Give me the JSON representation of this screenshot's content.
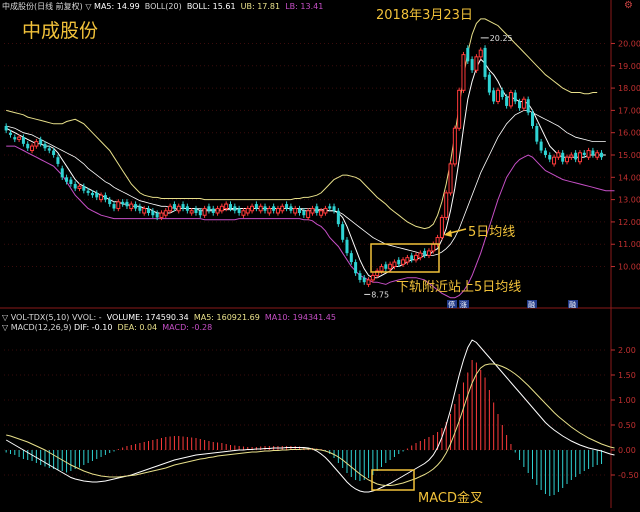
{
  "header": {
    "stock": "中成股份(日线 前复权)",
    "ma5": "MA5: 14.99",
    "boll": "BOLL(20)",
    "boll_mid": "BOLL: 15.61",
    "ub": "UB: 17.81",
    "lb": "LB: 13.41"
  },
  "vol_header": {
    "name": "VOL-TDX(5,10)",
    "vvol": "VVOL: -",
    "volume": "VOLUME: 174590.34",
    "ma5": "MA5: 160921.69",
    "ma10": "MA10: 194341.45"
  },
  "macd_header": {
    "name": "MACD(12,26,9)",
    "dif": "DIF: -0.10",
    "dea": "DEA: 0.04",
    "macd": "MACD: -0.28"
  },
  "annotations": {
    "title": "中成股份",
    "date": "2018年3月23日",
    "ma5_label": "5日均线",
    "lower_band": "下轨附近站上5日均线",
    "macd_cross": "MACD金叉",
    "high_price": "20.25",
    "low_price": "8.75"
  },
  "markers": [
    "停",
    "涨",
    "融",
    "融"
  ],
  "colors": {
    "up": "#ff3b3b",
    "down": "#2fd3d3",
    "ma5": "#ffffff",
    "boll_mid": "#ffffff",
    "boll_upper": "#e8e08a",
    "boll_lower": "#c64fc6",
    "annotation": "#f2c23a",
    "axis": "#c03030"
  },
  "chart_data": [
    {
      "type": "candlestick",
      "yticks": [
        "20.00",
        "19.00",
        "18.00",
        "17.00",
        "16.00",
        "15.00",
        "14.00",
        "13.00",
        "12.00",
        "11.00",
        "10.00"
      ],
      "ylim": [
        8.5,
        21.5
      ],
      "close": [
        16.1,
        15.9,
        15.7,
        15.8,
        15.5,
        15.3,
        15.4,
        15.6,
        15.5,
        15.3,
        15.2,
        15.0,
        14.6,
        14.0,
        13.8,
        13.7,
        13.5,
        13.6,
        13.4,
        13.3,
        13.2,
        13.1,
        13.2,
        13.0,
        12.8,
        12.6,
        12.9,
        12.8,
        12.7,
        12.8,
        12.6,
        12.5,
        12.6,
        12.4,
        12.3,
        12.2,
        12.4,
        12.5,
        12.7,
        12.6,
        12.7,
        12.6,
        12.5,
        12.5,
        12.4,
        12.3,
        12.6,
        12.5,
        12.4,
        12.6,
        12.7,
        12.8,
        12.6,
        12.5,
        12.4,
        12.5,
        12.6,
        12.7,
        12.6,
        12.7,
        12.5,
        12.6,
        12.5,
        12.6,
        12.7,
        12.6,
        12.5,
        12.6,
        12.4,
        12.3,
        12.5,
        12.6,
        12.4,
        12.5,
        12.6,
        12.6,
        12.5,
        11.9,
        11.2,
        10.6,
        10.2,
        9.7,
        9.4,
        9.3,
        9.4,
        9.6,
        9.8,
        10.0,
        9.9,
        10.1,
        10.2,
        10.1,
        10.3,
        10.4,
        10.3,
        10.5,
        10.6,
        10.5,
        10.7,
        11.0,
        11.3,
        12.2,
        13.3,
        14.6,
        16.2,
        17.9,
        19.5,
        19.2,
        18.8,
        19.4,
        19.7,
        18.5,
        17.8,
        17.4,
        17.9,
        17.6,
        17.2,
        17.8,
        17.4,
        17.1,
        17.5,
        16.9,
        16.3,
        15.6,
        15.2,
        15.0,
        14.8,
        14.9,
        15.1,
        14.7,
        14.9,
        15.0,
        14.8,
        15.1,
        15.0,
        15.2,
        15.0,
        15.1,
        14.9,
        15.0
      ],
      "open": [
        16.3,
        16.0,
        15.8,
        15.7,
        15.8,
        15.5,
        15.2,
        15.4,
        15.7,
        15.5,
        15.3,
        15.2,
        14.9,
        14.4,
        14.0,
        13.9,
        13.7,
        13.5,
        13.6,
        13.4,
        13.3,
        13.3,
        13.0,
        13.2,
        13.0,
        12.8,
        12.6,
        12.9,
        12.9,
        12.6,
        12.8,
        12.7,
        12.4,
        12.6,
        12.5,
        12.4,
        12.2,
        12.3,
        12.5,
        12.8,
        12.5,
        12.8,
        12.7,
        12.4,
        12.6,
        12.5,
        12.3,
        12.7,
        12.6,
        12.4,
        12.5,
        12.6,
        12.8,
        12.7,
        12.6,
        12.3,
        12.4,
        12.5,
        12.8,
        12.5,
        12.7,
        12.4,
        12.7,
        12.4,
        12.5,
        12.8,
        12.7,
        12.4,
        12.6,
        12.5,
        12.2,
        12.4,
        12.7,
        12.3,
        12.4,
        12.7,
        12.7,
        12.5,
        11.9,
        11.2,
        10.6,
        10.2,
        9.7,
        9.5,
        9.2,
        9.4,
        9.6,
        9.8,
        10.1,
        9.9,
        10.0,
        10.3,
        10.1,
        10.2,
        10.5,
        10.3,
        10.4,
        10.7,
        10.5,
        10.7,
        11.0,
        11.3,
        12.2,
        13.3,
        14.6,
        16.2,
        17.9,
        19.8,
        19.3,
        18.8,
        19.4,
        19.8,
        18.6,
        17.9,
        17.4,
        17.9,
        17.6,
        17.2,
        17.8,
        17.4,
        17.1,
        17.5,
        16.9,
        16.3,
        15.6,
        15.2,
        15.0,
        14.6,
        14.9,
        15.1,
        14.7,
        14.9,
        15.1,
        14.7,
        15.1,
        14.9,
        15.2,
        14.9,
        15.1
      ],
      "ma5": [
        16.2,
        16.1,
        16.0,
        15.9,
        15.8,
        15.7,
        15.6,
        15.5,
        15.5,
        15.4,
        15.4,
        15.3,
        15.1,
        14.8,
        14.5,
        14.2,
        13.9,
        13.7,
        13.6,
        13.5,
        13.4,
        13.3,
        13.2,
        13.1,
        13.0,
        12.9,
        12.9,
        12.8,
        12.8,
        12.7,
        12.7,
        12.7,
        12.6,
        12.6,
        12.5,
        12.4,
        12.4,
        12.4,
        12.4,
        12.5,
        12.6,
        12.6,
        12.6,
        12.6,
        12.6,
        12.5,
        12.5,
        12.5,
        12.5,
        12.5,
        12.5,
        12.6,
        12.6,
        12.6,
        12.6,
        12.6,
        12.6,
        12.6,
        12.6,
        12.6,
        12.6,
        12.6,
        12.6,
        12.6,
        12.6,
        12.6,
        12.6,
        12.6,
        12.6,
        12.5,
        12.5,
        12.5,
        12.5,
        12.5,
        12.5,
        12.5,
        12.5,
        12.4,
        12.2,
        11.8,
        11.3,
        10.8,
        10.3,
        9.9,
        9.6,
        9.5,
        9.5,
        9.6,
        9.7,
        9.8,
        10.0,
        10.0,
        10.1,
        10.2,
        10.3,
        10.3,
        10.4,
        10.5,
        10.5,
        10.7,
        10.8,
        11.2,
        11.7,
        12.5,
        13.5,
        14.8,
        16.2,
        17.5,
        18.3,
        18.9,
        19.3,
        19.1,
        18.8,
        18.6,
        18.3,
        17.9,
        17.6,
        17.6,
        17.5,
        17.4,
        17.4,
        17.3,
        17.0,
        16.6,
        16.2,
        15.8,
        15.4,
        15.2,
        15.0,
        14.9,
        14.9,
        14.9,
        14.9,
        14.9,
        14.9,
        15.0,
        15.0,
        15.0,
        15.0,
        15.0
      ],
      "boll_mid": [
        16.3,
        16.25,
        16.2,
        16.1,
        16.0,
        15.95,
        15.9,
        15.8,
        15.7,
        15.6,
        15.5,
        15.4,
        15.3,
        15.2,
        15.1,
        15.0,
        14.9,
        14.75,
        14.6,
        14.4,
        14.25,
        14.1,
        13.95,
        13.8,
        13.7,
        13.55,
        13.45,
        13.35,
        13.25,
        13.15,
        13.05,
        12.95,
        12.9,
        12.85,
        12.8,
        12.75,
        12.7,
        12.7,
        12.65,
        12.6,
        12.6,
        12.6,
        12.6,
        12.6,
        12.6,
        12.6,
        12.55,
        12.55,
        12.55,
        12.55,
        12.55,
        12.55,
        12.55,
        12.55,
        12.6,
        12.6,
        12.6,
        12.6,
        12.6,
        12.6,
        12.6,
        12.6,
        12.6,
        12.6,
        12.6,
        12.6,
        12.6,
        12.6,
        12.6,
        12.6,
        12.6,
        12.6,
        12.55,
        12.55,
        12.55,
        12.5,
        12.5,
        12.45,
        12.35,
        12.2,
        12.05,
        11.9,
        11.75,
        11.6,
        11.45,
        11.3,
        11.2,
        11.1,
        11.0,
        10.95,
        10.9,
        10.85,
        10.8,
        10.75,
        10.7,
        10.65,
        10.6,
        10.55,
        10.5,
        10.5,
        10.55,
        10.65,
        10.8,
        11.0,
        11.3,
        11.7,
        12.2,
        12.7,
        13.2,
        13.7,
        14.2,
        14.6,
        15.0,
        15.4,
        15.8,
        16.1,
        16.4,
        16.6,
        16.8,
        16.9,
        17.0,
        17.0,
        16.9,
        16.8,
        16.7,
        16.6,
        16.5,
        16.4,
        16.3,
        16.15,
        16.0,
        15.9,
        15.8,
        15.75,
        15.7,
        15.65,
        15.6,
        15.6,
        15.6,
        15.6
      ],
      "boll_upper": [
        17.0,
        16.95,
        16.9,
        16.85,
        16.8,
        16.7,
        16.65,
        16.6,
        16.55,
        16.5,
        16.45,
        16.4,
        16.4,
        16.4,
        16.5,
        16.55,
        16.6,
        16.5,
        16.4,
        16.2,
        16.0,
        15.8,
        15.6,
        15.4,
        15.2,
        14.9,
        14.6,
        14.3,
        14.0,
        13.7,
        13.5,
        13.3,
        13.2,
        13.15,
        13.1,
        13.1,
        13.05,
        13.05,
        13.05,
        13.05,
        13.05,
        13.05,
        13.05,
        13.05,
        13.05,
        13.05,
        13.0,
        13.0,
        13.0,
        13.0,
        13.0,
        13.0,
        13.0,
        13.0,
        13.0,
        13.0,
        13.0,
        13.0,
        13.0,
        13.0,
        13.0,
        13.0,
        13.0,
        13.0,
        13.0,
        13.0,
        13.0,
        13.05,
        13.05,
        13.1,
        13.1,
        13.15,
        13.2,
        13.3,
        13.5,
        13.7,
        13.9,
        14.0,
        14.1,
        14.1,
        14.05,
        14.0,
        13.9,
        13.7,
        13.5,
        13.3,
        13.1,
        12.95,
        12.8,
        12.6,
        12.45,
        12.3,
        12.15,
        12.0,
        11.9,
        11.8,
        11.75,
        11.7,
        11.75,
        11.9,
        12.3,
        12.9,
        13.7,
        14.7,
        15.9,
        17.2,
        18.5,
        19.6,
        20.4,
        20.9,
        21.1,
        21.1,
        21.0,
        20.9,
        20.8,
        20.6,
        20.4,
        20.2,
        20.0,
        19.8,
        19.6,
        19.4,
        19.2,
        19.0,
        18.8,
        18.6,
        18.45,
        18.3,
        18.15,
        18.0,
        17.9,
        17.8,
        17.8,
        17.8,
        17.75,
        17.75,
        17.8,
        17.8
      ],
      "boll_lower": [
        15.4,
        15.4,
        15.4,
        15.3,
        15.2,
        15.1,
        15.0,
        14.9,
        14.8,
        14.7,
        14.6,
        14.5,
        14.3,
        14.1,
        13.8,
        13.5,
        13.2,
        13.0,
        12.8,
        12.6,
        12.5,
        12.4,
        12.3,
        12.25,
        12.2,
        12.15,
        12.15,
        12.15,
        12.15,
        12.15,
        12.15,
        12.15,
        12.15,
        12.15,
        12.15,
        12.15,
        12.15,
        12.15,
        12.15,
        12.15,
        12.15,
        12.15,
        12.15,
        12.15,
        12.15,
        12.15,
        12.1,
        12.1,
        12.1,
        12.1,
        12.1,
        12.1,
        12.1,
        12.1,
        12.15,
        12.15,
        12.15,
        12.15,
        12.15,
        12.15,
        12.15,
        12.15,
        12.15,
        12.15,
        12.15,
        12.15,
        12.15,
        12.15,
        12.15,
        12.1,
        12.1,
        12.05,
        11.9,
        11.8,
        11.6,
        11.3,
        11.1,
        10.9,
        10.6,
        10.3,
        10.0,
        9.8,
        9.6,
        9.5,
        9.4,
        9.3,
        9.3,
        9.25,
        9.2,
        9.3,
        9.35,
        9.4,
        9.45,
        9.5,
        9.5,
        9.5,
        9.45,
        9.4,
        9.25,
        9.1,
        8.95,
        8.8,
        8.7,
        8.6,
        8.6,
        8.7,
        8.9,
        9.2,
        9.6,
        10.1,
        10.6,
        11.2,
        11.8,
        12.4,
        13.0,
        13.5,
        14.0,
        14.3,
        14.6,
        14.8,
        14.9,
        15.0,
        14.9,
        14.7,
        14.5,
        14.3,
        14.2,
        14.1,
        14.0,
        13.9,
        13.85,
        13.8,
        13.75,
        13.7,
        13.65,
        13.6,
        13.55,
        13.5,
        13.45,
        13.4,
        13.4,
        13.4
      ]
    },
    {
      "type": "bar",
      "name": "MACD",
      "yticks": [
        "2.00",
        "1.50",
        "1.00",
        "0.50",
        "0.00",
        "-0.50"
      ],
      "ylim": [
        -1.1,
        2.3
      ],
      "macd": [
        -0.05,
        -0.08,
        -0.1,
        -0.14,
        -0.18,
        -0.2,
        -0.22,
        -0.26,
        -0.3,
        -0.33,
        -0.36,
        -0.38,
        -0.4,
        -0.42,
        -0.45,
        -0.42,
        -0.38,
        -0.35,
        -0.3,
        -0.26,
        -0.22,
        -0.18,
        -0.14,
        -0.1,
        -0.06,
        -0.03,
        0.02,
        0.05,
        0.08,
        0.1,
        0.12,
        0.14,
        0.16,
        0.18,
        0.2,
        0.22,
        0.24,
        0.26,
        0.27,
        0.28,
        0.28,
        0.27,
        0.26,
        0.25,
        0.24,
        0.22,
        0.2,
        0.18,
        0.16,
        0.15,
        0.14,
        0.12,
        0.1,
        0.09,
        0.08,
        0.07,
        0.06,
        0.06,
        0.06,
        0.07,
        0.08,
        0.08,
        0.08,
        0.08,
        0.08,
        0.08,
        0.08,
        0.08,
        0.07,
        0.06,
        0.05,
        0.04,
        0.03,
        0.02,
        -0.02,
        -0.08,
        -0.16,
        -0.26,
        -0.36,
        -0.46,
        -0.54,
        -0.6,
        -0.62,
        -0.6,
        -0.56,
        -0.5,
        -0.42,
        -0.34,
        -0.26,
        -0.2,
        -0.14,
        -0.08,
        -0.03,
        0.03,
        0.09,
        0.14,
        0.18,
        0.22,
        0.26,
        0.3,
        0.36,
        0.44,
        0.56,
        0.72,
        0.92,
        1.12,
        1.35,
        1.55,
        1.8,
        1.75,
        1.6,
        1.45,
        1.2,
        0.95,
        0.72,
        0.5,
        0.3,
        0.12,
        -0.05,
        -0.2,
        -0.34,
        -0.46,
        -0.58,
        -0.7,
        -0.8,
        -0.88,
        -0.92,
        -0.9,
        -0.84,
        -0.76,
        -0.68,
        -0.6,
        -0.54,
        -0.48,
        -0.42,
        -0.38,
        -0.34,
        -0.3,
        -0.28
      ],
      "dif": [
        0.2,
        0.15,
        0.1,
        0.05,
        0.0,
        -0.05,
        -0.1,
        -0.15,
        -0.2,
        -0.25,
        -0.3,
        -0.35,
        -0.4,
        -0.45,
        -0.5,
        -0.55,
        -0.58,
        -0.6,
        -0.62,
        -0.63,
        -0.64,
        -0.64,
        -0.63,
        -0.62,
        -0.6,
        -0.58,
        -0.56,
        -0.54,
        -0.52,
        -0.5,
        -0.47,
        -0.44,
        -0.41,
        -0.38,
        -0.35,
        -0.32,
        -0.29,
        -0.26,
        -0.23,
        -0.2,
        -0.18,
        -0.16,
        -0.14,
        -0.12,
        -0.1,
        -0.09,
        -0.08,
        -0.07,
        -0.06,
        -0.05,
        -0.04,
        -0.03,
        -0.02,
        -0.01,
        0.0,
        0.0,
        0.01,
        0.01,
        0.02,
        0.02,
        0.03,
        0.03,
        0.04,
        0.04,
        0.04,
        0.05,
        0.05,
        0.05,
        0.05,
        0.05,
        0.04,
        0.02,
        -0.02,
        -0.08,
        -0.15,
        -0.24,
        -0.34,
        -0.44,
        -0.54,
        -0.64,
        -0.72,
        -0.78,
        -0.82,
        -0.84,
        -0.84,
        -0.82,
        -0.79,
        -0.75,
        -0.71,
        -0.67,
        -0.62,
        -0.57,
        -0.52,
        -0.47,
        -0.42,
        -0.37,
        -0.32,
        -0.27,
        -0.2,
        -0.1,
        0.05,
        0.25,
        0.5,
        0.8,
        1.15,
        1.5,
        1.8,
        2.05,
        2.2,
        2.15,
        2.05,
        1.95,
        1.85,
        1.75,
        1.65,
        1.55,
        1.45,
        1.35,
        1.25,
        1.15,
        1.05,
        0.95,
        0.85,
        0.75,
        0.65,
        0.55,
        0.47,
        0.4,
        0.34,
        0.28,
        0.23,
        0.18,
        0.14,
        0.1,
        0.07,
        0.04,
        0.02,
        0.0,
        -0.02,
        -0.05,
        -0.08,
        -0.1
      ],
      "dea": [
        0.3,
        0.28,
        0.25,
        0.22,
        0.19,
        0.16,
        0.12,
        0.08,
        0.04,
        0.0,
        -0.05,
        -0.1,
        -0.15,
        -0.2,
        -0.25,
        -0.3,
        -0.34,
        -0.38,
        -0.42,
        -0.45,
        -0.48,
        -0.5,
        -0.52,
        -0.53,
        -0.54,
        -0.54,
        -0.54,
        -0.53,
        -0.52,
        -0.51,
        -0.5,
        -0.48,
        -0.46,
        -0.44,
        -0.42,
        -0.4,
        -0.38,
        -0.36,
        -0.33,
        -0.3,
        -0.28,
        -0.26,
        -0.24,
        -0.22,
        -0.2,
        -0.18,
        -0.17,
        -0.15,
        -0.14,
        -0.12,
        -0.11,
        -0.1,
        -0.09,
        -0.08,
        -0.07,
        -0.06,
        -0.05,
        -0.04,
        -0.04,
        -0.03,
        -0.02,
        -0.02,
        -0.01,
        -0.01,
        0.0,
        0.0,
        0.01,
        0.01,
        0.01,
        0.02,
        0.02,
        0.02,
        0.01,
        0.0,
        -0.02,
        -0.05,
        -0.09,
        -0.14,
        -0.2,
        -0.27,
        -0.34,
        -0.41,
        -0.48,
        -0.54,
        -0.6,
        -0.64,
        -0.68,
        -0.7,
        -0.71,
        -0.71,
        -0.7,
        -0.68,
        -0.66,
        -0.63,
        -0.6,
        -0.57,
        -0.53,
        -0.49,
        -0.44,
        -0.38,
        -0.3,
        -0.2,
        -0.06,
        0.12,
        0.34,
        0.58,
        0.84,
        1.1,
        1.34,
        1.52,
        1.64,
        1.7,
        1.72,
        1.72,
        1.7,
        1.67,
        1.63,
        1.58,
        1.52,
        1.45,
        1.37,
        1.29,
        1.2,
        1.11,
        1.02,
        0.93,
        0.84,
        0.75,
        0.67,
        0.6,
        0.53,
        0.46,
        0.4,
        0.34,
        0.29,
        0.24,
        0.2,
        0.16,
        0.12,
        0.09,
        0.06,
        0.04
      ]
    }
  ]
}
